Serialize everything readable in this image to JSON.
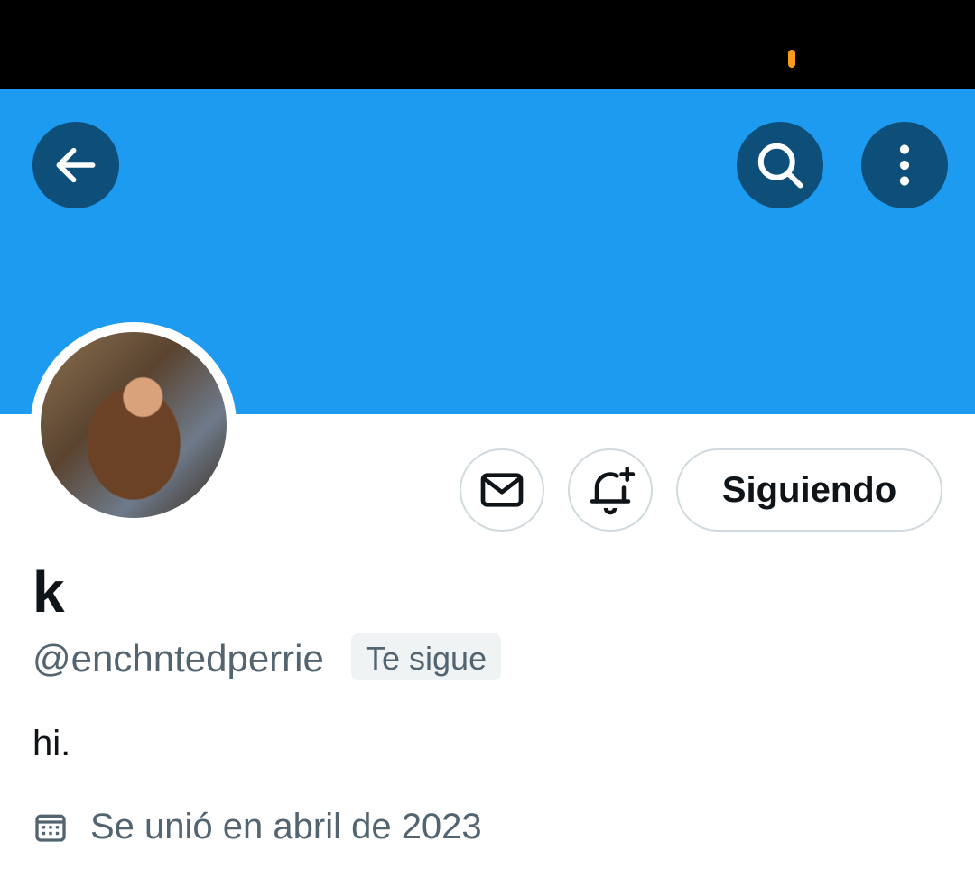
{
  "profile": {
    "name": "k",
    "handle": "@enchntedperrie",
    "follows_you_badge": "Te sigue",
    "bio": "hi.",
    "joined": "Se unió en abril de 2023"
  },
  "actions": {
    "following_label": "Siguiendo"
  },
  "icons": {
    "back": "arrow-left-icon",
    "search": "search-icon",
    "more": "more-vertical-icon",
    "message": "envelope-icon",
    "notify": "bell-plus-icon",
    "calendar": "calendar-icon"
  },
  "colors": {
    "banner": "#1d9bf0",
    "overlay_button": "#0e4f7a",
    "secondary_text": "#536471",
    "status_indicator": "#f99b1c"
  }
}
